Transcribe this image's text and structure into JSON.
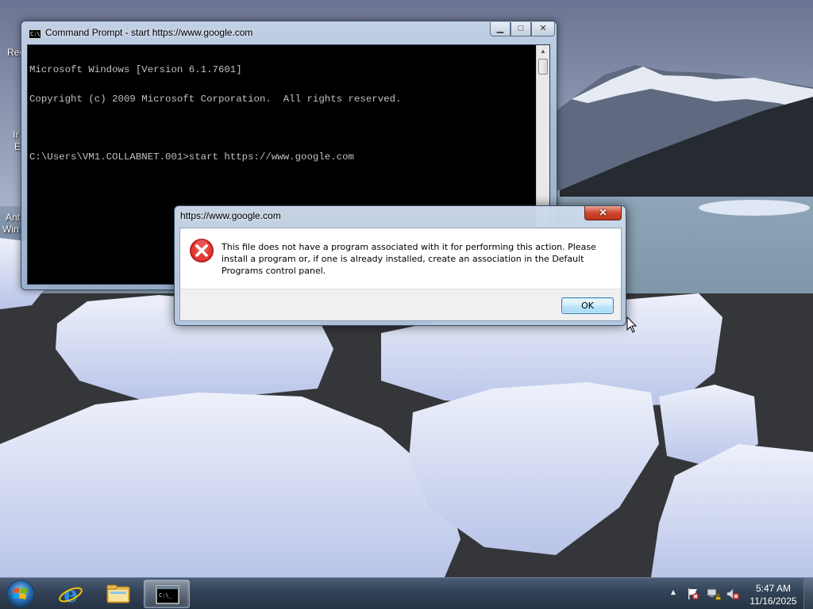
{
  "desktop": {
    "icon_labels": [
      "Rec",
      "Ir",
      "E",
      "Ant",
      "Win"
    ]
  },
  "cmd_window": {
    "title": "Command Prompt - start  https://www.google.com",
    "lines": [
      "Microsoft Windows [Version 6.1.7601]",
      "Copyright (c) 2009 Microsoft Corporation.  All rights reserved.",
      "",
      "C:\\Users\\VM1.COLLABNET.001>start https://www.google.com"
    ],
    "icon": "cmd-icon",
    "minimize_label": "▁",
    "maximize_label": "□",
    "close_label": "✕"
  },
  "dialog": {
    "title": "https://www.google.com",
    "close_label": "✕",
    "icon": "error-icon",
    "message": "This file does not have a program associated with it for performing this action. Please install a program or, if one is already installed, create an association in the Default Programs control panel.",
    "ok_label": "OK"
  },
  "taskbar": {
    "start_icon": "windows-start-icon",
    "pinned": [
      "internet-explorer-icon",
      "windows-explorer-icon",
      "command-prompt-icon"
    ],
    "tray_arrow": "▲",
    "tray_icons": [
      "action-center-flag-icon",
      "network-warning-icon",
      "volume-muted-icon"
    ],
    "clock_time": "5:47 AM",
    "clock_date": "11/16/2025"
  },
  "colors": {
    "console_bg": "#000000",
    "console_fg": "#c0c0c0",
    "error_red": "#d32f2f",
    "close_red": "#c9432a"
  }
}
